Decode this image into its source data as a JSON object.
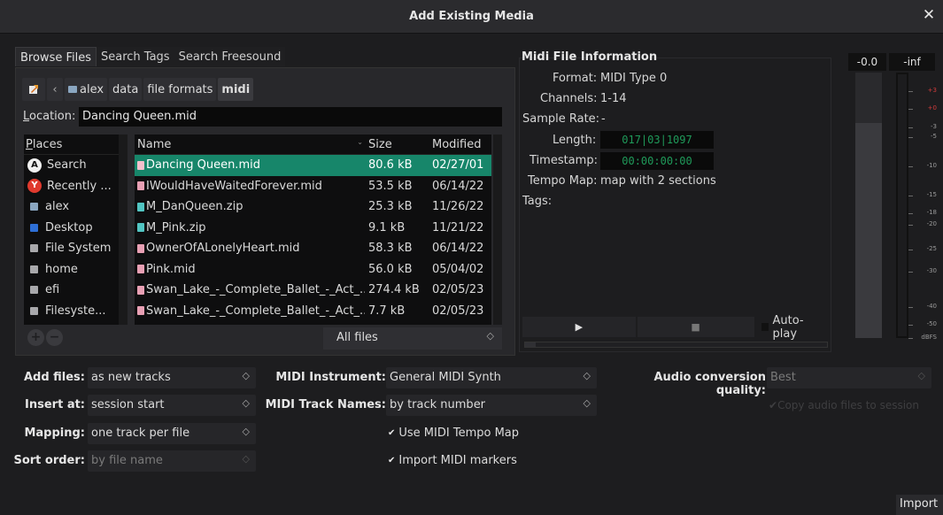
{
  "window": {
    "title": "Add Existing Media",
    "close_glyph": "✕"
  },
  "tabs": [
    "Browse Files",
    "Search Tags",
    "Search Freesound"
  ],
  "path": {
    "segments": [
      "alex",
      "data",
      "file formats",
      "midi"
    ],
    "back_glyph": "‹"
  },
  "location": {
    "label_prefix": "L",
    "label_rest": "ocation:",
    "value": "Dancing Queen.mid"
  },
  "places": {
    "header_u": "P",
    "header_rest": "laces",
    "items": [
      {
        "label": "Search",
        "icon": "search-icon"
      },
      {
        "label": "Recently ...",
        "icon": "recent-icon"
      },
      {
        "label": "alex",
        "icon": "home-folder-icon"
      },
      {
        "label": "Desktop",
        "icon": "desktop-icon"
      },
      {
        "label": "File System",
        "icon": "drive-icon"
      },
      {
        "label": "home",
        "icon": "drive-icon"
      },
      {
        "label": "efi",
        "icon": "drive-icon"
      },
      {
        "label": "Filesyste...",
        "icon": "drive-icon"
      }
    ],
    "add_glyph": "+",
    "remove_glyph": "−"
  },
  "files": {
    "columns": {
      "name": "Name",
      "size": "Size",
      "modified": "Modified",
      "sort_glyph": "⌄"
    },
    "rows": [
      {
        "name": "Dancing Queen.mid",
        "size": "80.6 kB",
        "modified": "02/27/01",
        "type": "midi"
      },
      {
        "name": "IWouldHaveWaitedForever.mid",
        "size": "53.5 kB",
        "modified": "06/14/22",
        "type": "midi"
      },
      {
        "name": "M_DanQueen.zip",
        "size": "25.3 kB",
        "modified": "11/26/22",
        "type": "zip"
      },
      {
        "name": "M_Pink.zip",
        "size": "9.1 kB",
        "modified": "11/21/22",
        "type": "zip"
      },
      {
        "name": "OwnerOfALonelyHeart.mid",
        "size": "58.3 kB",
        "modified": "06/14/22",
        "type": "midi"
      },
      {
        "name": "Pink.mid",
        "size": "56.0 kB",
        "modified": "05/04/02",
        "type": "midi"
      },
      {
        "name": "Swan_Lake_-_Complete_Ballet_-_Act_...",
        "size": "274.4 kB",
        "modified": "02/05/23",
        "type": "midi"
      },
      {
        "name": "Swan_Lake_-_Complete_Ballet_-_Act_...",
        "size": "7.7 kB",
        "modified": "02/05/23",
        "type": "midi"
      }
    ],
    "selected_index": 0,
    "filter": "All files",
    "combo_arrow": "◇"
  },
  "midi_info": {
    "title": "Midi File Information",
    "format_label": "Format:",
    "format_value": "MIDI Type 0",
    "channels_label": "Channels:",
    "channels_value": "1-14",
    "sample_rate_label": "Sample Rate:",
    "sample_rate_value": "-",
    "length_label": "Length:",
    "length_value": "017|03|1097",
    "timestamp_label": "Timestamp:",
    "timestamp_value": "00:00:00:00",
    "tempo_map_label": "Tempo Map:",
    "tempo_map_value": "map with 2 sections",
    "tags_label": "Tags:",
    "play_glyph": "▶",
    "stop_glyph": "■",
    "autoplay_label": "Auto-play"
  },
  "meters": {
    "peak_left": "-0.0",
    "peak_right": "-inf",
    "scale": [
      "+3",
      "+0",
      "-3",
      "-5",
      "-10",
      "-15",
      "-18",
      "-20",
      "-25",
      "-30",
      "-40",
      "-50",
      "dBFS"
    ],
    "level_left": 0.81
  },
  "options": {
    "add_files_label": "Add files:",
    "add_files_value": "as new tracks",
    "insert_at_label": "Insert at:",
    "insert_at_value": "session start",
    "mapping_label": "Mapping:",
    "mapping_value": "one track per file",
    "sort_order_label": "Sort order:",
    "sort_order_value": "by file name",
    "midi_instrument_label": "MIDI Instrument:",
    "midi_instrument_value": "General MIDI Synth",
    "midi_track_names_label": "MIDI Track Names:",
    "midi_track_names_value": "by track number",
    "use_tempo_map_label": "Use MIDI Tempo Map",
    "import_markers_label": "Import MIDI markers",
    "check_glyph": "✔",
    "audio_quality_label": "Audio conversion quality:",
    "audio_quality_value": "Best",
    "copy_files_label": "Copy audio files to session"
  },
  "import_label": "Import"
}
